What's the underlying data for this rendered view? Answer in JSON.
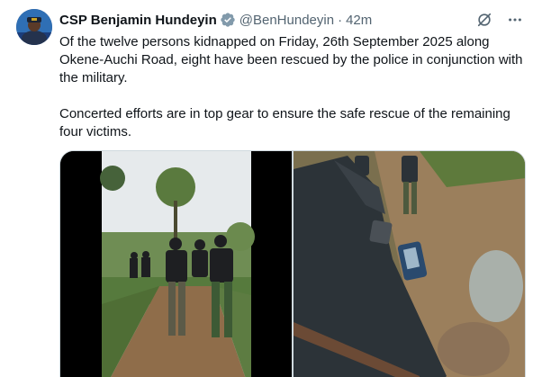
{
  "author": {
    "display_name": "CSP Benjamin Hundeyin",
    "handle": "@BenHundeyin",
    "separator": "·",
    "time": "42m",
    "verified_color": "#829aab"
  },
  "tweet": {
    "paragraph_1": "Of the twelve persons kidnapped on Friday, 26th September 2025 along Okene-Auchi Road, eight have been rescued by the police in conjunction with the military.",
    "paragraph_2": "Concerted efforts are in top gear to ensure the safe rescue of the remaining four victims."
  },
  "icons": {
    "verified": "verified-badge-icon",
    "grok": "grok-icon",
    "more": "more-options-icon"
  },
  "colors": {
    "text": "#0f1419",
    "secondary": "#536471",
    "border": "#cfd9de"
  }
}
